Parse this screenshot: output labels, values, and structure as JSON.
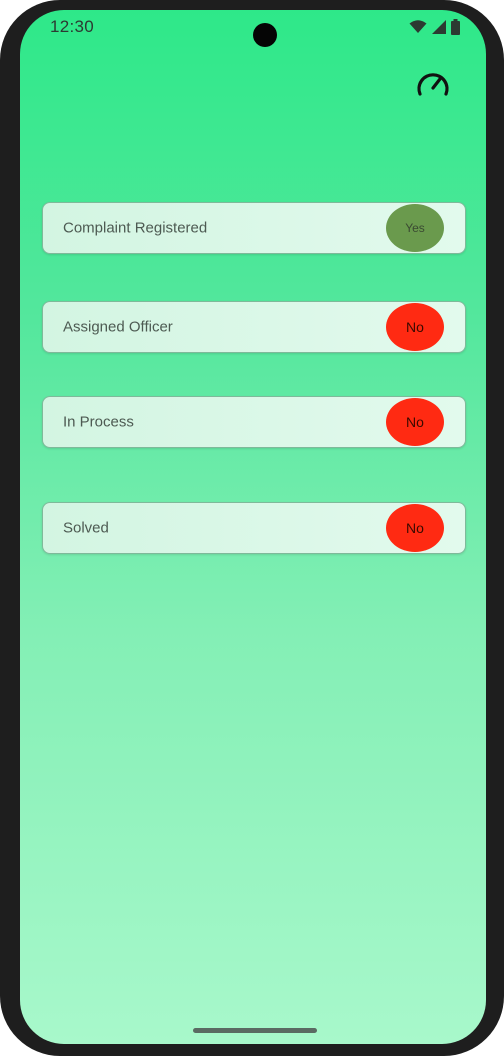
{
  "status_bar": {
    "time": "12:30",
    "icons": [
      "wifi-icon",
      "signal-icon",
      "battery-icon"
    ]
  },
  "header": {
    "action_icon": "speedometer-icon"
  },
  "rows": [
    {
      "label": "Complaint Registered",
      "status": "Yes",
      "status_color": "#6a9a4d"
    },
    {
      "label": "Assigned Officer",
      "status": "No",
      "status_color": "#ff2a12"
    },
    {
      "label": "In Process",
      "status": "No",
      "status_color": "#ff2a12"
    },
    {
      "label": "Solved",
      "status": "No",
      "status_color": "#ff2a12"
    }
  ],
  "colors": {
    "background_top": "#2ee889",
    "background_bottom": "#a8f8cb",
    "row_background": "#d3f5e2",
    "yes": "#6a9a4d",
    "no": "#ff2a12"
  }
}
